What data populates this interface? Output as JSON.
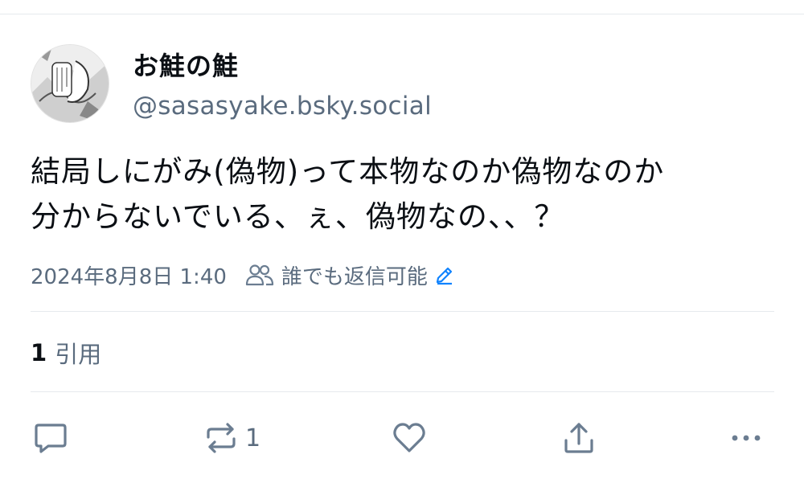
{
  "post": {
    "author": {
      "display_name": "お鮭の鮭",
      "handle": "@sasasyake.bsky.social",
      "avatar_icon": "manga-panel-avatar"
    },
    "text_line1": "結局しにがみ(偽物)って本物なのか偽物なのか",
    "text_line2": "分からないでいる、ぇ、偽物なの、、？",
    "timestamp": "2024年8月8日 1:40",
    "reply_setting": "誰でも返信可能",
    "quotes": {
      "count": "1",
      "label": "引用"
    }
  },
  "actions": {
    "reply": {
      "icon": "comment-icon"
    },
    "repost": {
      "icon": "repost-icon",
      "count": "1"
    },
    "like": {
      "icon": "heart-icon"
    },
    "share": {
      "icon": "share-icon"
    },
    "more": {
      "icon": "more-icon"
    }
  },
  "colors": {
    "text_primary": "#0b0f14",
    "text_secondary": "#5a6b7e",
    "accent": "#1083fe",
    "icon": "#6b7d91",
    "divider": "#e6e9ed"
  }
}
